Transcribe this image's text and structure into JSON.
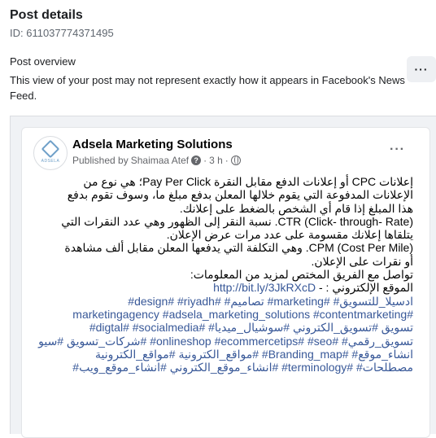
{
  "header": {
    "title": "Post details",
    "post_id": "ID: 611037774371495"
  },
  "overview": {
    "label": "Post overview",
    "note": "This view of your post may not represent exactly how it appears in Facebook's News Feed.",
    "more_icon": "more-horizontal-icon",
    "more_label": "···"
  },
  "post": {
    "avatar_brand": "ADSELA",
    "page_name": "Adsela Marketing Solutions",
    "published_by": "Published by",
    "author": "Shaimaa Atef",
    "help": "?",
    "time": "3 h",
    "audience_icon": "globe-icon",
    "more_label": "···",
    "body_lines": [
      "إعلانات CPC أو إعلانات الدفع مقابل النقرة Pay Per Click؛ هي نوع من",
      "الإعلانات المدفوعة التي يقوم خلالها المعلن بدفع مبلغ ما، وسوف تقوم بدفع",
      "هذا المبلغ إذا قام أي الشخص بالضغط على إعلانك.",
      "CTR (Click- through- Rate). نسبة النقر إلى الظهور وهي عدد النقرات التي",
      "يتلقاها إعلانك مقسومة على عدد مرات عرض الإعلان.",
      "CPM (Cost Per Mile). وهي التكلفة التي يدفعها المعلن مقابل ألف مشاهدة",
      "أو نقرات على الإعلان.",
      "تواصل مع الفريق المختص لمزيد من المعلومات:"
    ],
    "website_label": "الموقع الإلكتروني : -",
    "website_url": "http://bit.ly/3JkRXcD",
    "hashtag_lines": [
      "ادسيلا_للتسويق# #marketing# تصاميم# #design# #riyadh#",
      "#marketingagency #adsela_marketing_solutions #contentmarketing",
      "تسويق #تسويق_الكتروني #سوشيال_ميديا# #digtal# #socialmedia#",
      "تسويق_رقمي# #onlineshop #ecommercetips# #seo# #شركات_تسويق #سيو",
      "انشاء_موقع# #Branding_map# #مواقع_الكترونية #مواقع_الكترونية",
      "مصطلحات# #terminology# #انشاء_موقع_الكتروني #انشاء_موقع_ويب#"
    ]
  }
}
